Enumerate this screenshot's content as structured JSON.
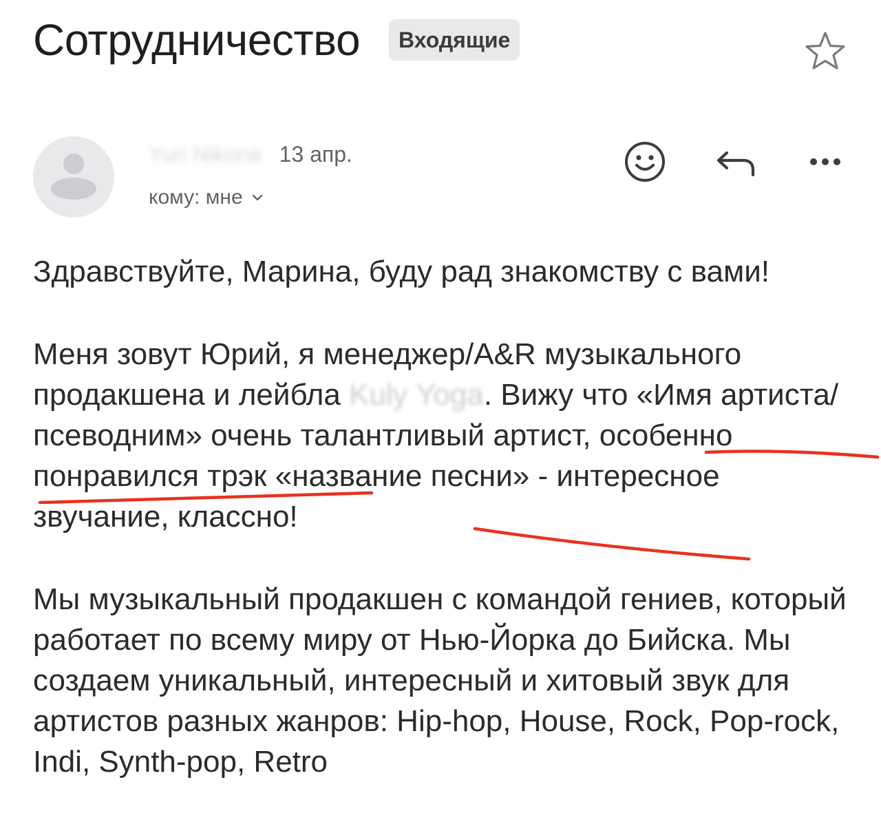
{
  "header": {
    "subject": "Сотрудничество",
    "label": "Входящие",
    "star_icon": "star-outline-icon"
  },
  "message": {
    "sender_name": "Yuri Nikona",
    "date": "13 апр.",
    "recipient": "кому: мне",
    "actions": {
      "emoji_icon": "emoji-smile-icon",
      "reply_icon": "reply-icon",
      "more_icon": "more-horizontal-icon"
    }
  },
  "body": {
    "p1": "Здравствуйте, Марина, буду рад знакомству с вами!",
    "p2_a": "Меня зовут Юрий, я менеджер/A&R музыкального продакшена и лейбла ",
    "p2_label": "Kuly Yoga",
    "p2_b": ". Вижу что «Имя артиста/псеводним» очень талантливый артист, особенно понравился трэк «название песни» - интересное звучание, классно!",
    "p3": "Мы музыкальный продакшен с командой гениев, который работает по всему миру от Нью-Йорка до Бийска. Мы создаем уникальный, интересный и хитовый звук для артистов разных жанров: Hip-hop, House, Rock, Pop-rock, Indi, Synth-pop, Retro"
  },
  "colors": {
    "annotation": "#e8321e",
    "chip_bg": "#e9e9e9",
    "avatar_bg": "#e9e9ec"
  }
}
